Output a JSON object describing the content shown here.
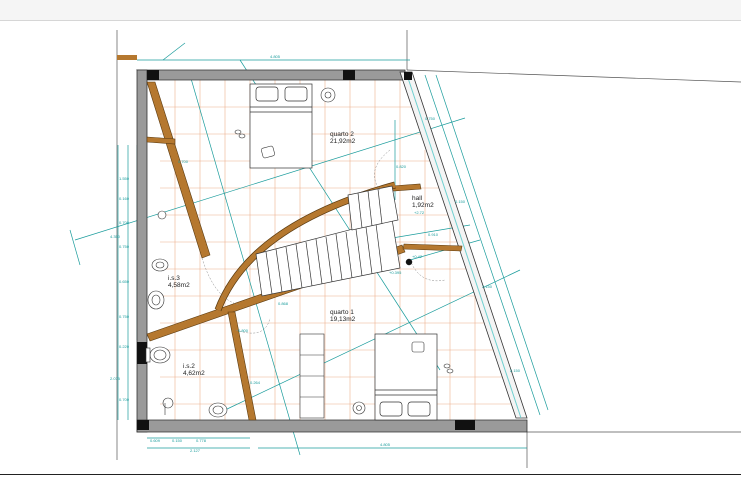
{
  "colors": {
    "wall": "#9a9a9a",
    "wall_outline": "#333333",
    "timber": "#b5782f",
    "grid": "#e8a27a",
    "dimension": "#1a9c9c",
    "glass": "#6fd0d0"
  },
  "rooms": [
    {
      "id": "quarto2",
      "name": "quarto 2",
      "area": "21,92m2"
    },
    {
      "id": "hall",
      "name": "hall",
      "area": "1,92m2"
    },
    {
      "id": "is3",
      "name": "i.s.3",
      "area": "4,58m2"
    },
    {
      "id": "quarto1",
      "name": "quarto 1",
      "area": "19,13m2"
    },
    {
      "id": "is2",
      "name": "i.s.2",
      "area": "4,62m2"
    }
  ],
  "dimensions": {
    "top_total": "4.805",
    "bottom_total": "4.805",
    "bottom_left_total": "2.127",
    "bottom_seg1": "0.609",
    "bottom_seg2": "0.150",
    "bottom_seg3": "0.778",
    "left_1": "1.550",
    "left_2": "0.160",
    "left_3": "0.700",
    "left_4": "0.750",
    "left_5": "0.650",
    "left_6": "0.750",
    "left_7": "0.220",
    "left_8": "2.075",
    "left_9": "0.700",
    "left_total": "4.350",
    "right_1": "0.750",
    "right_2": "0.150",
    "right_3": "2.150",
    "right_4": "2.150",
    "level_1": "+0.395",
    "level_2": "+0.42",
    "level_3": "+2.72",
    "door_1": "0.820",
    "door_2": "0.700",
    "door_3": "0.910",
    "door_4": "0.800",
    "stair_1": "0.868",
    "stair_2": "0.264"
  },
  "icons": {
    "beds": "bed-icon",
    "slippers": "slippers-icon",
    "toilet": "toilet-icon",
    "sink": "sink-icon",
    "bidet": "bidet-icon",
    "shower": "shower-icon",
    "plant": "plant-icon"
  }
}
